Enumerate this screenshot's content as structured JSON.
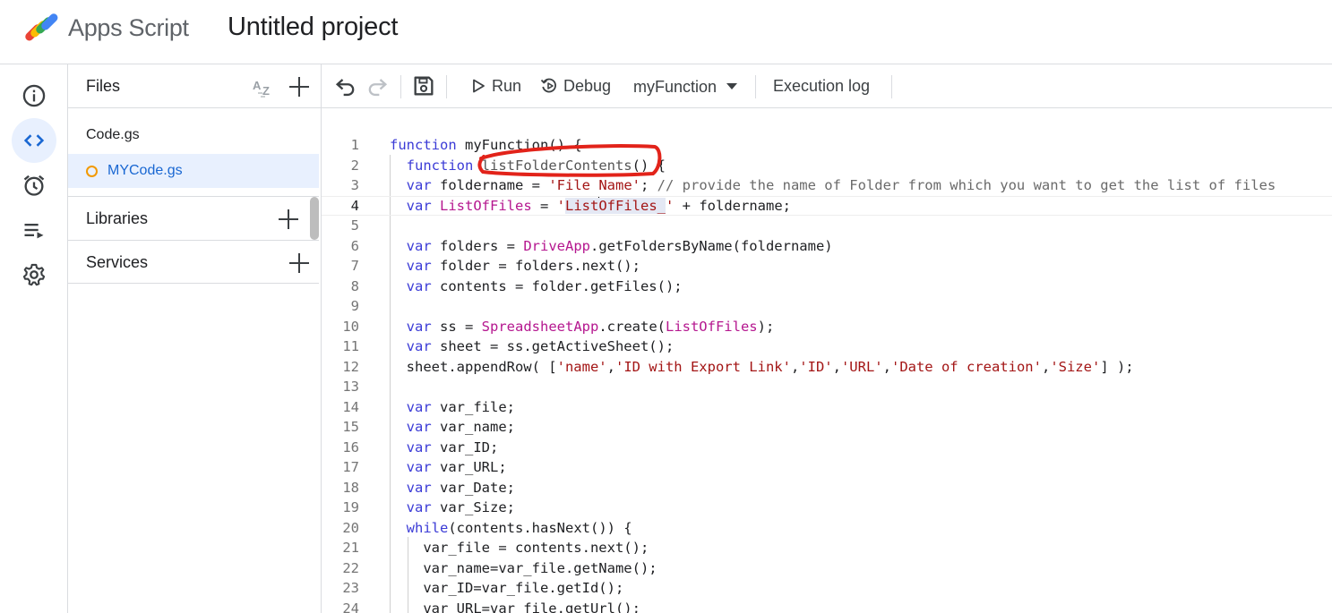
{
  "header": {
    "app_name": "Apps Script",
    "project_title": "Untitled project"
  },
  "rail": {
    "items": [
      {
        "icon": "info-icon",
        "label": "Overview",
        "active": false
      },
      {
        "icon": "code-icon",
        "label": "Editor",
        "active": true
      },
      {
        "icon": "alarm-clock-icon",
        "label": "Triggers",
        "active": false
      },
      {
        "icon": "executions-icon",
        "label": "Executions",
        "active": false
      },
      {
        "icon": "gear-icon",
        "label": "Project Settings",
        "active": false
      }
    ]
  },
  "files_panel": {
    "title": "Files",
    "files": [
      {
        "name": "Code.gs",
        "selected": false,
        "unsaved": false
      },
      {
        "name": "MYCode.gs",
        "selected": true,
        "unsaved": true
      }
    ],
    "sections": [
      {
        "label": "Libraries"
      },
      {
        "label": "Services"
      }
    ]
  },
  "toolbar": {
    "run_label": "Run",
    "debug_label": "Debug",
    "function_select": "myFunction",
    "execution_log_label": "Execution log"
  },
  "editor": {
    "current_line": 4,
    "lines": [
      {
        "n": "1",
        "text": "function myFunction() {"
      },
      {
        "n": "2",
        "text": "  function listFolderContents() {"
      },
      {
        "n": "3",
        "text": "  var foldername = 'File Name'; // provide the name of Folder from which you want to get the list of files"
      },
      {
        "n": "4",
        "text": "  var ListOfFiles = 'ListOfFiles_' + foldername;"
      },
      {
        "n": "5",
        "text": ""
      },
      {
        "n": "6",
        "text": "  var folders = DriveApp.getFoldersByName(foldername)"
      },
      {
        "n": "7",
        "text": "  var folder = folders.next();"
      },
      {
        "n": "8",
        "text": "  var contents = folder.getFiles();"
      },
      {
        "n": "9",
        "text": ""
      },
      {
        "n": "10",
        "text": "  var ss = SpreadsheetApp.create(ListOfFiles);"
      },
      {
        "n": "11",
        "text": "  var sheet = ss.getActiveSheet();"
      },
      {
        "n": "12",
        "text": "  sheet.appendRow( ['name','ID with Export Link','ID','URL','Date of creation','Size'] );"
      },
      {
        "n": "13",
        "text": ""
      },
      {
        "n": "14",
        "text": "  var var_file;"
      },
      {
        "n": "15",
        "text": "  var var_name;"
      },
      {
        "n": "16",
        "text": "  var var_ID;"
      },
      {
        "n": "17",
        "text": "  var var_URL;"
      },
      {
        "n": "18",
        "text": "  var var_Date;"
      },
      {
        "n": "19",
        "text": "  var var_Size;"
      },
      {
        "n": "20",
        "text": "  while(contents.hasNext()) {"
      },
      {
        "n": "21",
        "text": "    var_file = contents.next();"
      },
      {
        "n": "22",
        "text": "    var_name=var_file.getName();"
      },
      {
        "n": "23",
        "text": "    var_ID=var_file.getId();"
      },
      {
        "n": "24",
        "text": "    var_URL=var_file.getUrl();"
      }
    ]
  },
  "annotation": {
    "shape": "hand-drawn ellipse",
    "color": "#e2231a",
    "target_text": "listFolderContents()"
  },
  "colors": {
    "accent": "#1967d2",
    "selected_bg": "#e8f0fe",
    "keyword": "#3b3bd6",
    "string": "#a31515",
    "builtin": "#b5178f",
    "unsaved_dot": "#f29900"
  }
}
